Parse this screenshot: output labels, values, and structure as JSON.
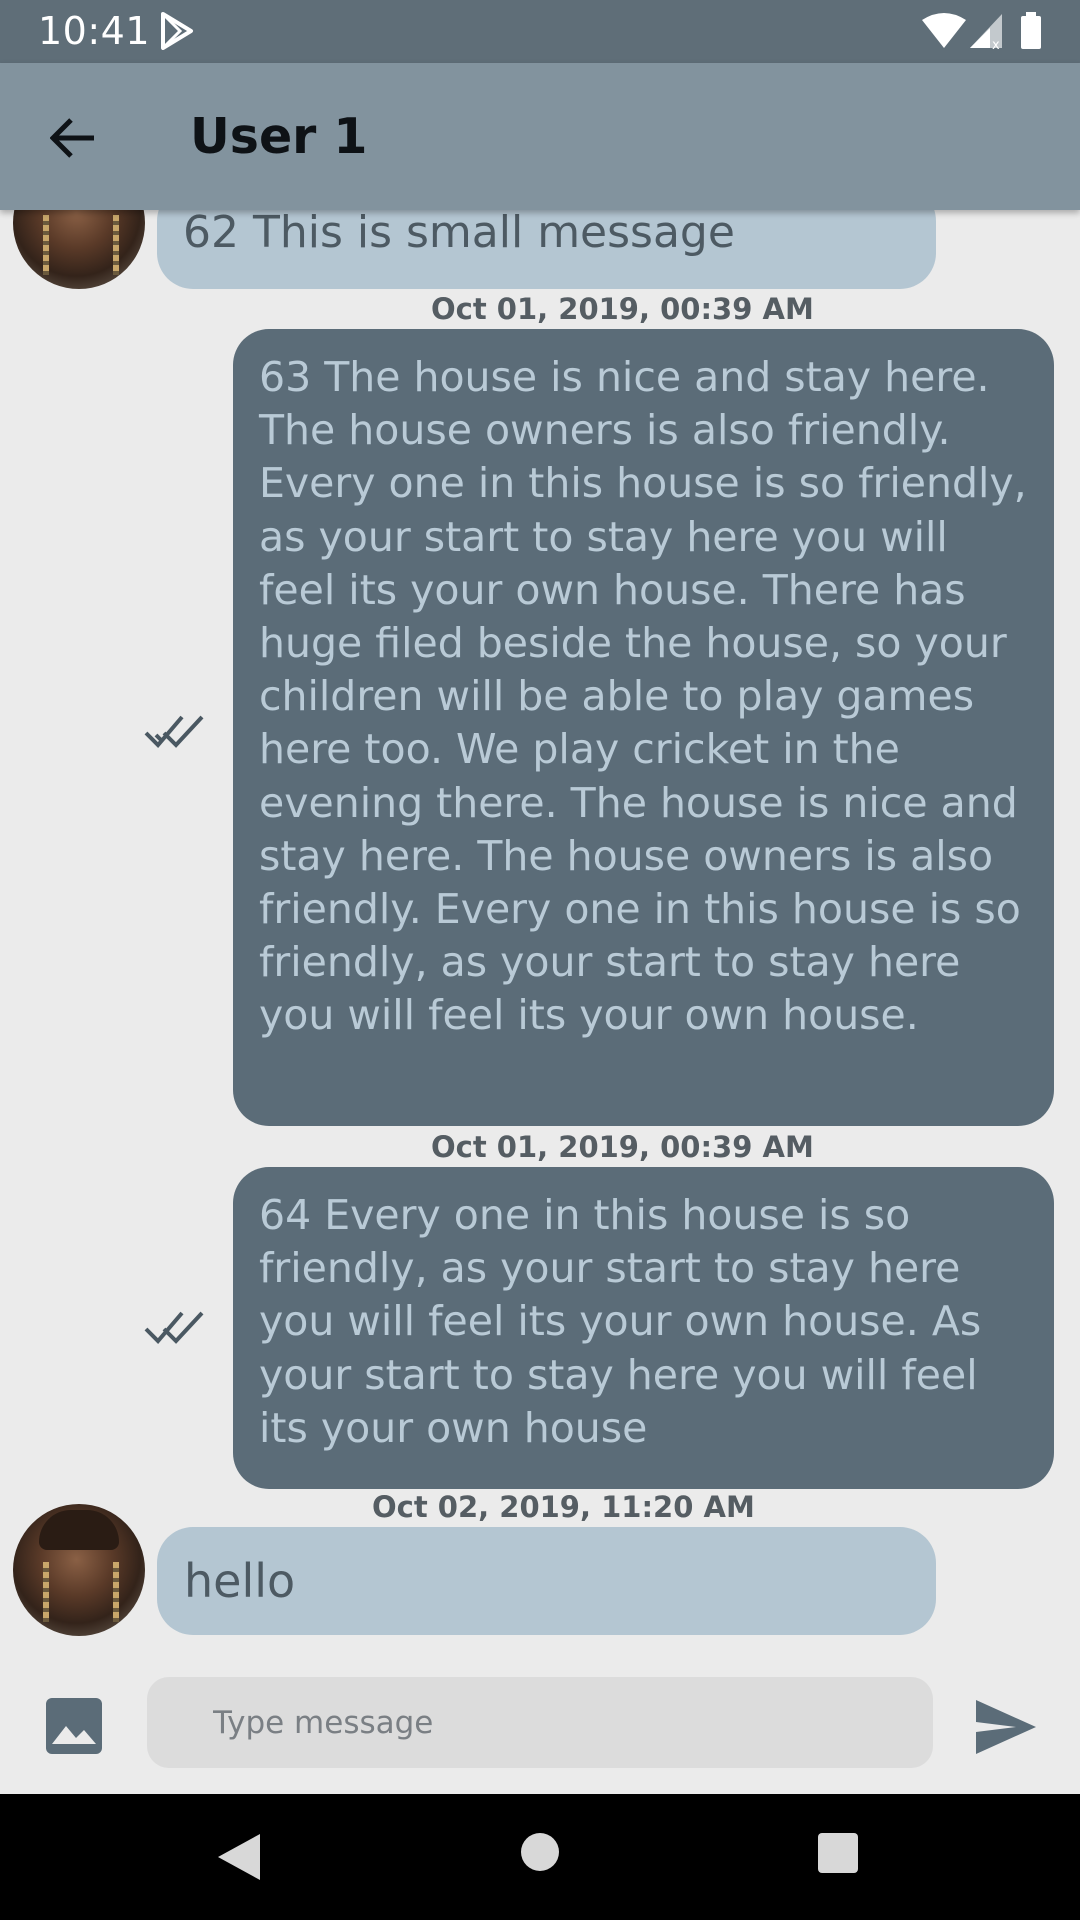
{
  "status_bar": {
    "time": "10:41",
    "icons": [
      "play-store-icon",
      "wifi-icon",
      "signal-icon",
      "battery-icon"
    ]
  },
  "app_bar": {
    "title": "User 1",
    "back_icon": "arrow-back-icon"
  },
  "messages": [
    {
      "direction": "incoming",
      "text": "62 This is small message",
      "avatar": "user-1-avatar"
    },
    {
      "timestamp": "Oct 01, 2019, 00:39 AM",
      "direction": "outgoing",
      "status": "read",
      "text": "63 The house is nice and stay here. The house owners is also friendly. Every one in this house is so friendly, as your start to stay here you will feel its your own house. There has huge filed beside the house, so your children will be able to play games here too. We play cricket in the evening there. The house is nice and stay here. The house owners is also friendly. Every one in this house is so friendly, as your start to stay here you will feel its your own house."
    },
    {
      "timestamp": "Oct 01, 2019, 00:39 AM",
      "direction": "outgoing",
      "status": "read",
      "text": "64 Every one in this house is so friendly, as your start to stay here you will feel its your own house. As your start to stay here you will feel its your own house"
    },
    {
      "timestamp": "Oct 02, 2019, 11:20 AM",
      "direction": "incoming",
      "text": "hello",
      "avatar": "user-1-avatar"
    }
  ],
  "input_bar": {
    "placeholder": "Type message",
    "value": "",
    "image_icon": "image-icon",
    "send_icon": "send-icon"
  },
  "nav_bar": {
    "icons": [
      "nav-back-icon",
      "nav-home-icon",
      "nav-recents-icon"
    ]
  },
  "colors": {
    "status_bar": "#5f6e78",
    "app_bar": "#82939e",
    "incoming_bubble": "#b4c6d2",
    "outgoing_bubble": "#5b6c78",
    "outgoing_text": "#b9cad6",
    "background": "#ebebeb"
  }
}
